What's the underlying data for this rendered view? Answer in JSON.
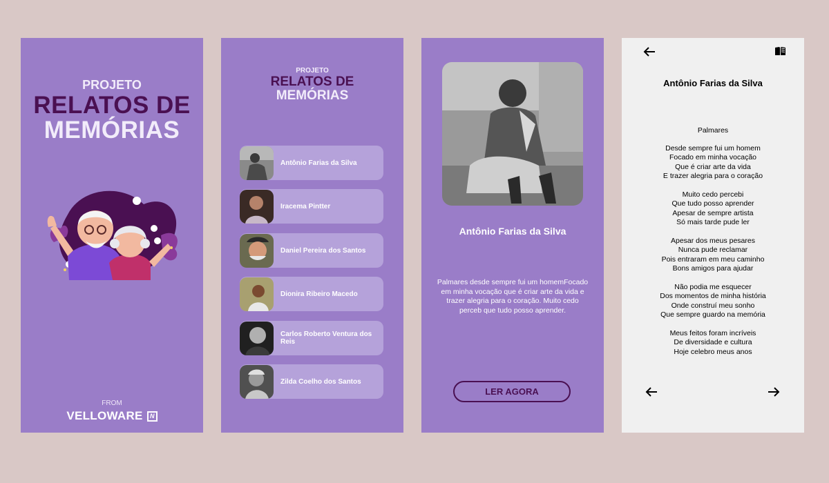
{
  "splash": {
    "projeto": "PROJETO",
    "relatos": "RELATOS DE",
    "memorias": "MEMÓRIAS",
    "from": "FROM",
    "brand": "VELLOWARE",
    "brand_logo": "N"
  },
  "list": {
    "projeto": "PROJETO",
    "relatos": "RELATOS DE",
    "memorias": "MEMÓRIAS",
    "people": [
      {
        "name": "Antônio Farias da Silva"
      },
      {
        "name": "Iracema Pintter"
      },
      {
        "name": "Daniel Pereira dos Santos"
      },
      {
        "name": "Dionira Ribeiro Macedo"
      },
      {
        "name": "Carlos Roberto Ventura dos Reis"
      },
      {
        "name": "Zilda Coelho dos Santos"
      }
    ]
  },
  "detail": {
    "name": "Antônio Farias da Silva",
    "excerpt": "Palmares  desde sempre fui um homemFocado em minha vocação que é criar arte da vida e trazer alegria para o coração.  Muito cedo perceb que tudo posso aprender.",
    "button": "LER AGORA"
  },
  "reader": {
    "title": "Antônio Farias da Silva",
    "poem_title": "Palmares",
    "stanzas": [
      [
        "Desde sempre fui um homem",
        "Focado em minha vocação",
        "Que é criar arte da vida",
        "E trazer alegria para o coração"
      ],
      [
        "Muito cedo percebi",
        "Que tudo posso aprender",
        "Apesar de sempre artista",
        "Só mais tarde pude ler"
      ],
      [
        "Apesar dos meus pesares",
        "Nunca pude reclamar",
        "Pois entraram em meu caminho",
        "Bons amigos para ajudar"
      ],
      [
        "Não podia me esquecer",
        "Dos momentos de minha história",
        "Onde construí meu sonho",
        "Que sempre guardo na memória"
      ],
      [
        "Meus feitos foram incríveis",
        "De diversidade e cultura",
        "Hoje celebro meus anos"
      ]
    ],
    "icons": {
      "back": "arrow-left-icon",
      "book": "book-icon",
      "prev": "arrow-left-icon",
      "next": "arrow-right-icon"
    }
  },
  "colors": {
    "background": "#d9c8c6",
    "purple": "#9a7dc8",
    "dark_purple": "#4a1052",
    "card": "#b5a2da",
    "reader_bg": "#f0f0f0"
  }
}
